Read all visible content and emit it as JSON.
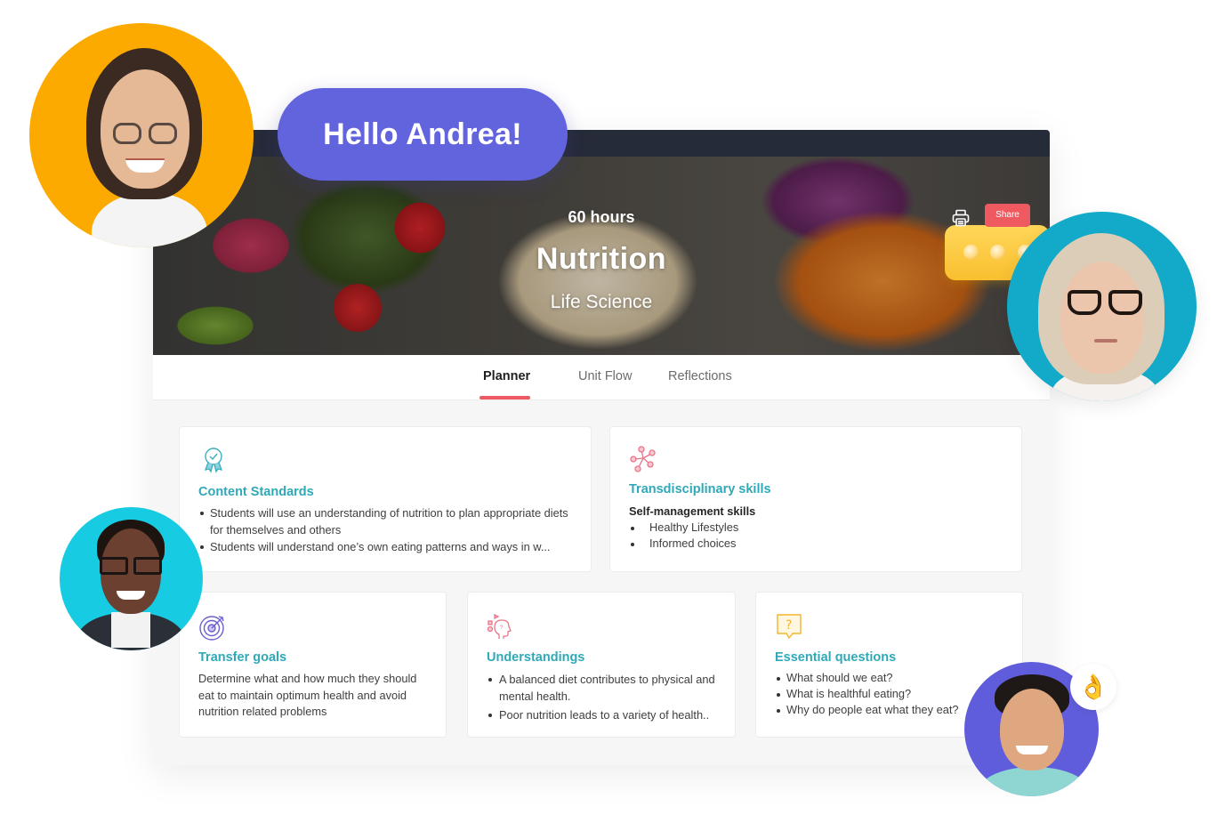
{
  "greeting": "Hello Andrea!",
  "unit": {
    "hours": "60 hours",
    "title": "Nutrition",
    "subject": "Life Science"
  },
  "actions": {
    "print_icon": "printer-icon",
    "share_label": "Share"
  },
  "colors": {
    "accent": "#ef5a60",
    "heading": "#2fa9b8",
    "greeting_bg": "#6264dd",
    "topbar": "#262b3a"
  },
  "tabs": [
    {
      "label": "Planner",
      "active": true
    },
    {
      "label": "Unit Flow",
      "active": false
    },
    {
      "label": "Reflections",
      "active": false
    }
  ],
  "cards": {
    "content_standards": {
      "icon": "award-ribbon-icon",
      "title": "Content Standards",
      "items": [
        "Students will use an understanding of nutrition to plan appropriate diets for themselves and others",
        "Students will understand one’s own eating patterns and ways in w..."
      ]
    },
    "transdisciplinary": {
      "icon": "network-nodes-icon",
      "title": "Transdisciplinary skills",
      "subtitle": "Self-management skills",
      "items": [
        "Healthy Lifestyles",
        "Informed choices"
      ]
    },
    "transfer_goals": {
      "icon": "target-icon",
      "title": "Transfer goals",
      "text": "Determine what and how much they should eat to maintain optimum health and avoid nutrition related problems"
    },
    "understandings": {
      "icon": "thinking-head-icon",
      "title": "Understandings",
      "items": [
        "A balanced diet contributes to physical and mental health.",
        "Poor nutrition leads to a variety of health.."
      ]
    },
    "essential_questions": {
      "icon": "question-bubble-icon",
      "title": "Essential questions",
      "items": [
        "What should we eat?",
        "What is healthful eating?",
        "Why do people eat what they eat?"
      ]
    }
  },
  "decor": {
    "chat_bubble": "typing-dots-icon",
    "reaction": "👌"
  }
}
